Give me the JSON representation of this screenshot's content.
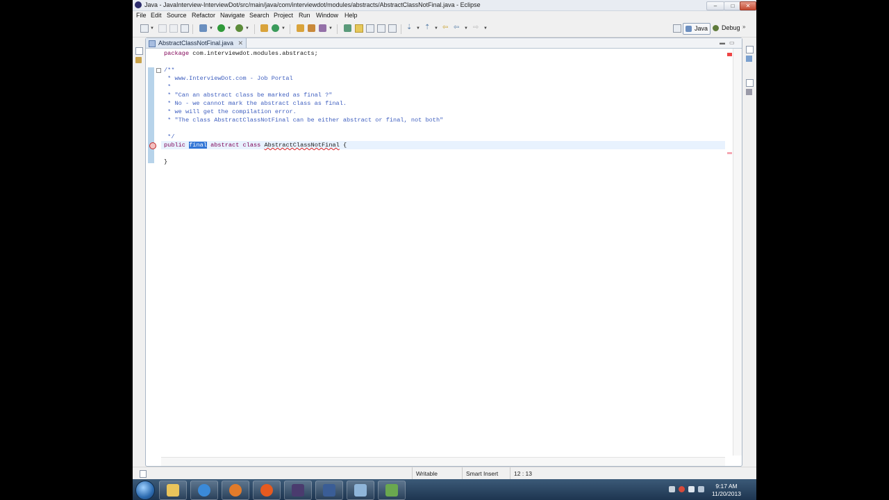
{
  "window": {
    "title": "Java - JavaInterview-InterviewDot/src/main/java/com/interviewdot/modules/abstracts/AbstractClassNotFinal.java - Eclipse",
    "controls": {
      "minimize": "–",
      "maximize": "□",
      "close": "✕"
    }
  },
  "menu": [
    "File",
    "Edit",
    "Source",
    "Refactor",
    "Navigate",
    "Search",
    "Project",
    "Run",
    "Window",
    "Help"
  ],
  "perspectives": [
    {
      "label": "Java",
      "active": true
    },
    {
      "label": "Debug",
      "active": false
    }
  ],
  "editor": {
    "tab_label": "AbstractClassNotFinal.java",
    "tab_close": "✕",
    "code": {
      "package_kw": "package",
      "package_name": " com.interviewdot.modules.abstracts;",
      "comment_lines": [
        "/**",
        " * www.InterviewDot.com - Job Portal",
        " *",
        " * \"Can an abstract class be marked as final ?\"",
        " * No - we cannot mark the abstract class as final.",
        " * we will get the compilation error.",
        " * \"The class AbstractClassNotFinal can be either abstract or final, not both\"",
        "",
        " */"
      ],
      "decl_public": "public",
      "decl_final": "final",
      "decl_abstract": "abstract",
      "decl_class": "class",
      "decl_name": "AbstractClassNotFinal",
      "decl_brace": " {",
      "closing_brace": "}"
    }
  },
  "statusbar": {
    "writable": "Writable",
    "insert_mode": "Smart Insert",
    "position": "12 : 13"
  },
  "taskbar": {
    "clock_time": "9:17 AM",
    "clock_date": "11/20/2013"
  },
  "colors": {
    "keyword": "#7f0055",
    "comment": "#3f5fbf",
    "selection": "#3175d6"
  }
}
